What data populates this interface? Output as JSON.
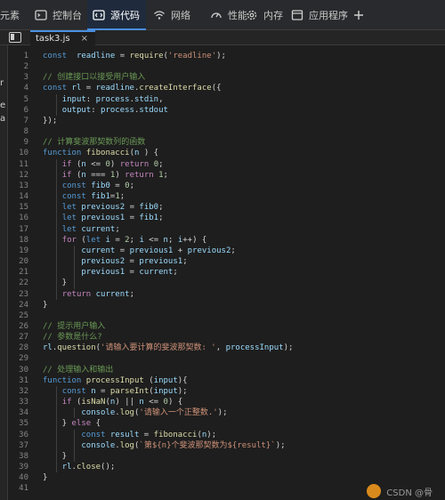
{
  "tabs": [
    {
      "id": "elements",
      "label": "元素",
      "icon": "",
      "active": false
    },
    {
      "id": "console",
      "label": "控制台",
      "icon": "console-icon",
      "active": false
    },
    {
      "id": "sources",
      "label": "源代码",
      "icon": "sources-icon",
      "active": true
    },
    {
      "id": "network",
      "label": "网络",
      "icon": "wifi-icon",
      "active": false
    },
    {
      "id": "performance",
      "label": "性能",
      "icon": "gauge-icon",
      "active": false
    },
    {
      "id": "memory",
      "label": "内存",
      "icon": "gear-icon",
      "active": false
    },
    {
      "id": "application",
      "label": "应用程序",
      "icon": "window-icon",
      "active": false
    }
  ],
  "add_tab_icon": "plus-icon",
  "file_tab": {
    "name": "task3.js",
    "close": "×"
  },
  "left_panel_glyphs": [
    "r",
    "e",
    "a"
  ],
  "watermark": "CSDN @骨",
  "code_lines": [
    {
      "n": "1",
      "tokens": [
        [
          "kw",
          "const"
        ],
        [
          "",
          "  "
        ],
        [
          "var",
          "readline"
        ],
        [
          "",
          " = "
        ],
        [
          "fn",
          "require"
        ],
        [
          "",
          "("
        ],
        [
          "str",
          "'readline'"
        ],
        [
          "",
          ");"
        ]
      ]
    },
    {
      "n": "2",
      "tokens": []
    },
    {
      "n": "3",
      "tokens": [
        [
          "com",
          "// 创建接口以接受用户输入"
        ]
      ]
    },
    {
      "n": "4",
      "tokens": [
        [
          "kw",
          "const"
        ],
        [
          "",
          " "
        ],
        [
          "var",
          "rl"
        ],
        [
          "",
          " = "
        ],
        [
          "var",
          "readline"
        ],
        [
          "",
          "."
        ],
        [
          "fn",
          "createInterface"
        ],
        [
          "",
          "({"
        ]
      ]
    },
    {
      "n": "5",
      "tokens": [
        [
          "",
          "    "
        ],
        [
          "var",
          "input"
        ],
        [
          "",
          ": "
        ],
        [
          "var",
          "process"
        ],
        [
          "",
          "."
        ],
        [
          "var",
          "stdin"
        ],
        [
          "",
          ","
        ]
      ]
    },
    {
      "n": "6",
      "tokens": [
        [
          "",
          "    "
        ],
        [
          "var",
          "output"
        ],
        [
          "",
          ": "
        ],
        [
          "var",
          "process"
        ],
        [
          "",
          "."
        ],
        [
          "var",
          "stdout"
        ]
      ]
    },
    {
      "n": "7",
      "tokens": [
        [
          "",
          "});"
        ]
      ]
    },
    {
      "n": "8",
      "tokens": []
    },
    {
      "n": "9",
      "tokens": [
        [
          "com",
          "// 计算斐波那契数列的函数"
        ]
      ]
    },
    {
      "n": "10",
      "tokens": [
        [
          "kw",
          "function"
        ],
        [
          "",
          " "
        ],
        [
          "fn",
          "fibonacci"
        ],
        [
          "",
          "("
        ],
        [
          "var",
          "n"
        ],
        [
          "",
          " ) {"
        ]
      ]
    },
    {
      "n": "11",
      "tokens": [
        [
          "",
          "    "
        ],
        [
          "ctl",
          "if"
        ],
        [
          "",
          " ("
        ],
        [
          "var",
          "n"
        ],
        [
          "",
          " <= "
        ],
        [
          "num",
          "0"
        ],
        [
          "",
          ") "
        ],
        [
          "ctl",
          "return"
        ],
        [
          "",
          " "
        ],
        [
          "num",
          "0"
        ],
        [
          "",
          ";"
        ]
      ]
    },
    {
      "n": "12",
      "tokens": [
        [
          "",
          "    "
        ],
        [
          "ctl",
          "if"
        ],
        [
          "",
          " ("
        ],
        [
          "var",
          "n"
        ],
        [
          "",
          " === "
        ],
        [
          "num",
          "1"
        ],
        [
          "",
          ") "
        ],
        [
          "ctl",
          "return"
        ],
        [
          "",
          " "
        ],
        [
          "num",
          "1"
        ],
        [
          "",
          ";"
        ]
      ]
    },
    {
      "n": "13",
      "tokens": [
        [
          "",
          "    "
        ],
        [
          "kw",
          "const"
        ],
        [
          "",
          " "
        ],
        [
          "var",
          "fib0"
        ],
        [
          "",
          " = "
        ],
        [
          "num",
          "0"
        ],
        [
          "",
          ";"
        ]
      ]
    },
    {
      "n": "14",
      "tokens": [
        [
          "",
          "    "
        ],
        [
          "kw",
          "const"
        ],
        [
          "",
          " "
        ],
        [
          "var",
          "fib1"
        ],
        [
          "",
          "="
        ],
        [
          "num",
          "1"
        ],
        [
          "",
          ";"
        ]
      ]
    },
    {
      "n": "15",
      "tokens": [
        [
          "",
          "    "
        ],
        [
          "kw",
          "let"
        ],
        [
          "",
          " "
        ],
        [
          "var",
          "previous2"
        ],
        [
          "",
          " = "
        ],
        [
          "var",
          "fib0"
        ],
        [
          "",
          ";"
        ]
      ]
    },
    {
      "n": "16",
      "tokens": [
        [
          "",
          "    "
        ],
        [
          "kw",
          "let"
        ],
        [
          "",
          " "
        ],
        [
          "var",
          "previous1"
        ],
        [
          "",
          " = "
        ],
        [
          "var",
          "fib1"
        ],
        [
          "",
          ";"
        ]
      ]
    },
    {
      "n": "17",
      "tokens": [
        [
          "",
          "    "
        ],
        [
          "kw",
          "let"
        ],
        [
          "",
          " "
        ],
        [
          "var",
          "current"
        ],
        [
          "",
          ";"
        ]
      ]
    },
    {
      "n": "18",
      "tokens": [
        [
          "",
          "    "
        ],
        [
          "ctl",
          "for"
        ],
        [
          "",
          " ("
        ],
        [
          "kw",
          "let"
        ],
        [
          "",
          " "
        ],
        [
          "var",
          "i"
        ],
        [
          "",
          " = "
        ],
        [
          "num",
          "2"
        ],
        [
          "",
          "; "
        ],
        [
          "var",
          "i"
        ],
        [
          "",
          " <= "
        ],
        [
          "var",
          "n"
        ],
        [
          "",
          "; "
        ],
        [
          "var",
          "i"
        ],
        [
          "",
          "++) {"
        ]
      ]
    },
    {
      "n": "19",
      "tokens": [
        [
          "",
          "        "
        ],
        [
          "var",
          "current"
        ],
        [
          "",
          " = "
        ],
        [
          "var",
          "previous1"
        ],
        [
          "",
          " + "
        ],
        [
          "var",
          "previous2"
        ],
        [
          "",
          ";"
        ]
      ]
    },
    {
      "n": "20",
      "tokens": [
        [
          "",
          "        "
        ],
        [
          "var",
          "previous2"
        ],
        [
          "",
          " = "
        ],
        [
          "var",
          "previous1"
        ],
        [
          "",
          ";"
        ]
      ]
    },
    {
      "n": "21",
      "tokens": [
        [
          "",
          "        "
        ],
        [
          "var",
          "previous1"
        ],
        [
          "",
          " = "
        ],
        [
          "var",
          "current"
        ],
        [
          "",
          ";"
        ]
      ]
    },
    {
      "n": "22",
      "tokens": [
        [
          "",
          "    }"
        ]
      ]
    },
    {
      "n": "23",
      "tokens": [
        [
          "",
          "    "
        ],
        [
          "ctl",
          "return"
        ],
        [
          "",
          " "
        ],
        [
          "var",
          "current"
        ],
        [
          "",
          ";"
        ]
      ]
    },
    {
      "n": "24",
      "tokens": [
        [
          "",
          "}"
        ]
      ]
    },
    {
      "n": "25",
      "tokens": []
    },
    {
      "n": "26",
      "tokens": [
        [
          "com",
          "// 提示用户输入"
        ]
      ]
    },
    {
      "n": "27",
      "tokens": [
        [
          "com",
          "// 参数是什么?"
        ]
      ]
    },
    {
      "n": "28",
      "tokens": [
        [
          "var",
          "rl"
        ],
        [
          "",
          "."
        ],
        [
          "fn",
          "question"
        ],
        [
          "",
          "("
        ],
        [
          "str",
          "'请输入要计算的斐波那契数: '"
        ],
        [
          "",
          ", "
        ],
        [
          "var",
          "processInput"
        ],
        [
          "",
          ");"
        ]
      ]
    },
    {
      "n": "29",
      "tokens": []
    },
    {
      "n": "30",
      "tokens": [
        [
          "com",
          "// 处理输入和输出"
        ]
      ]
    },
    {
      "n": "31",
      "tokens": [
        [
          "kw",
          "function"
        ],
        [
          "",
          " "
        ],
        [
          "fn",
          "processInput"
        ],
        [
          "",
          " ("
        ],
        [
          "var",
          "input"
        ],
        [
          "",
          "){"
        ]
      ]
    },
    {
      "n": "32",
      "tokens": [
        [
          "",
          "    "
        ],
        [
          "kw",
          "const"
        ],
        [
          "",
          " "
        ],
        [
          "var",
          "n"
        ],
        [
          "",
          " = "
        ],
        [
          "fn",
          "parseInt"
        ],
        [
          "",
          "("
        ],
        [
          "var",
          "input"
        ],
        [
          "",
          ");"
        ]
      ]
    },
    {
      "n": "33",
      "tokens": [
        [
          "",
          "    "
        ],
        [
          "ctl",
          "if"
        ],
        [
          "",
          " ("
        ],
        [
          "fn",
          "isNaN"
        ],
        [
          "",
          "("
        ],
        [
          "var",
          "n"
        ],
        [
          "",
          ") || "
        ],
        [
          "var",
          "n"
        ],
        [
          "",
          " <= "
        ],
        [
          "num",
          "0"
        ],
        [
          "",
          ") {"
        ]
      ]
    },
    {
      "n": "34",
      "tokens": [
        [
          "",
          "        "
        ],
        [
          "var",
          "console"
        ],
        [
          "",
          "."
        ],
        [
          "fn",
          "log"
        ],
        [
          "",
          "("
        ],
        [
          "str",
          "'请输入一个正整数.'"
        ],
        [
          "",
          ");"
        ]
      ]
    },
    {
      "n": "35",
      "tokens": [
        [
          "",
          "    } "
        ],
        [
          "ctl",
          "else"
        ],
        [
          "",
          " {"
        ]
      ]
    },
    {
      "n": "36",
      "tokens": [
        [
          "",
          "        "
        ],
        [
          "kw",
          "const"
        ],
        [
          "",
          " "
        ],
        [
          "var",
          "result"
        ],
        [
          "",
          " = "
        ],
        [
          "fn",
          "fibonacci"
        ],
        [
          "",
          "("
        ],
        [
          "var",
          "n"
        ],
        [
          "",
          ");"
        ]
      ]
    },
    {
      "n": "37",
      "tokens": [
        [
          "",
          "        "
        ],
        [
          "var",
          "console"
        ],
        [
          "",
          "."
        ],
        [
          "fn",
          "log"
        ],
        [
          "",
          "("
        ],
        [
          "str",
          "`第${n}个斐波那契数为${result}`"
        ],
        [
          "",
          ");"
        ]
      ]
    },
    {
      "n": "38",
      "tokens": [
        [
          "",
          "    }"
        ]
      ]
    },
    {
      "n": "39",
      "tokens": [
        [
          "",
          "    "
        ],
        [
          "var",
          "rl"
        ],
        [
          "",
          "."
        ],
        [
          "fn",
          "close"
        ],
        [
          "",
          "();"
        ]
      ]
    },
    {
      "n": "40",
      "tokens": [
        [
          "",
          "}"
        ]
      ]
    },
    {
      "n": "41",
      "tokens": []
    }
  ],
  "colors": {
    "keyword": "#569cd6",
    "control": "#c586c0",
    "variable": "#9cdcfe",
    "function": "#dcdcaa",
    "string": "#ce9178",
    "number": "#b5cea8",
    "comment": "#6a9955",
    "accent": "#4a90e2"
  }
}
